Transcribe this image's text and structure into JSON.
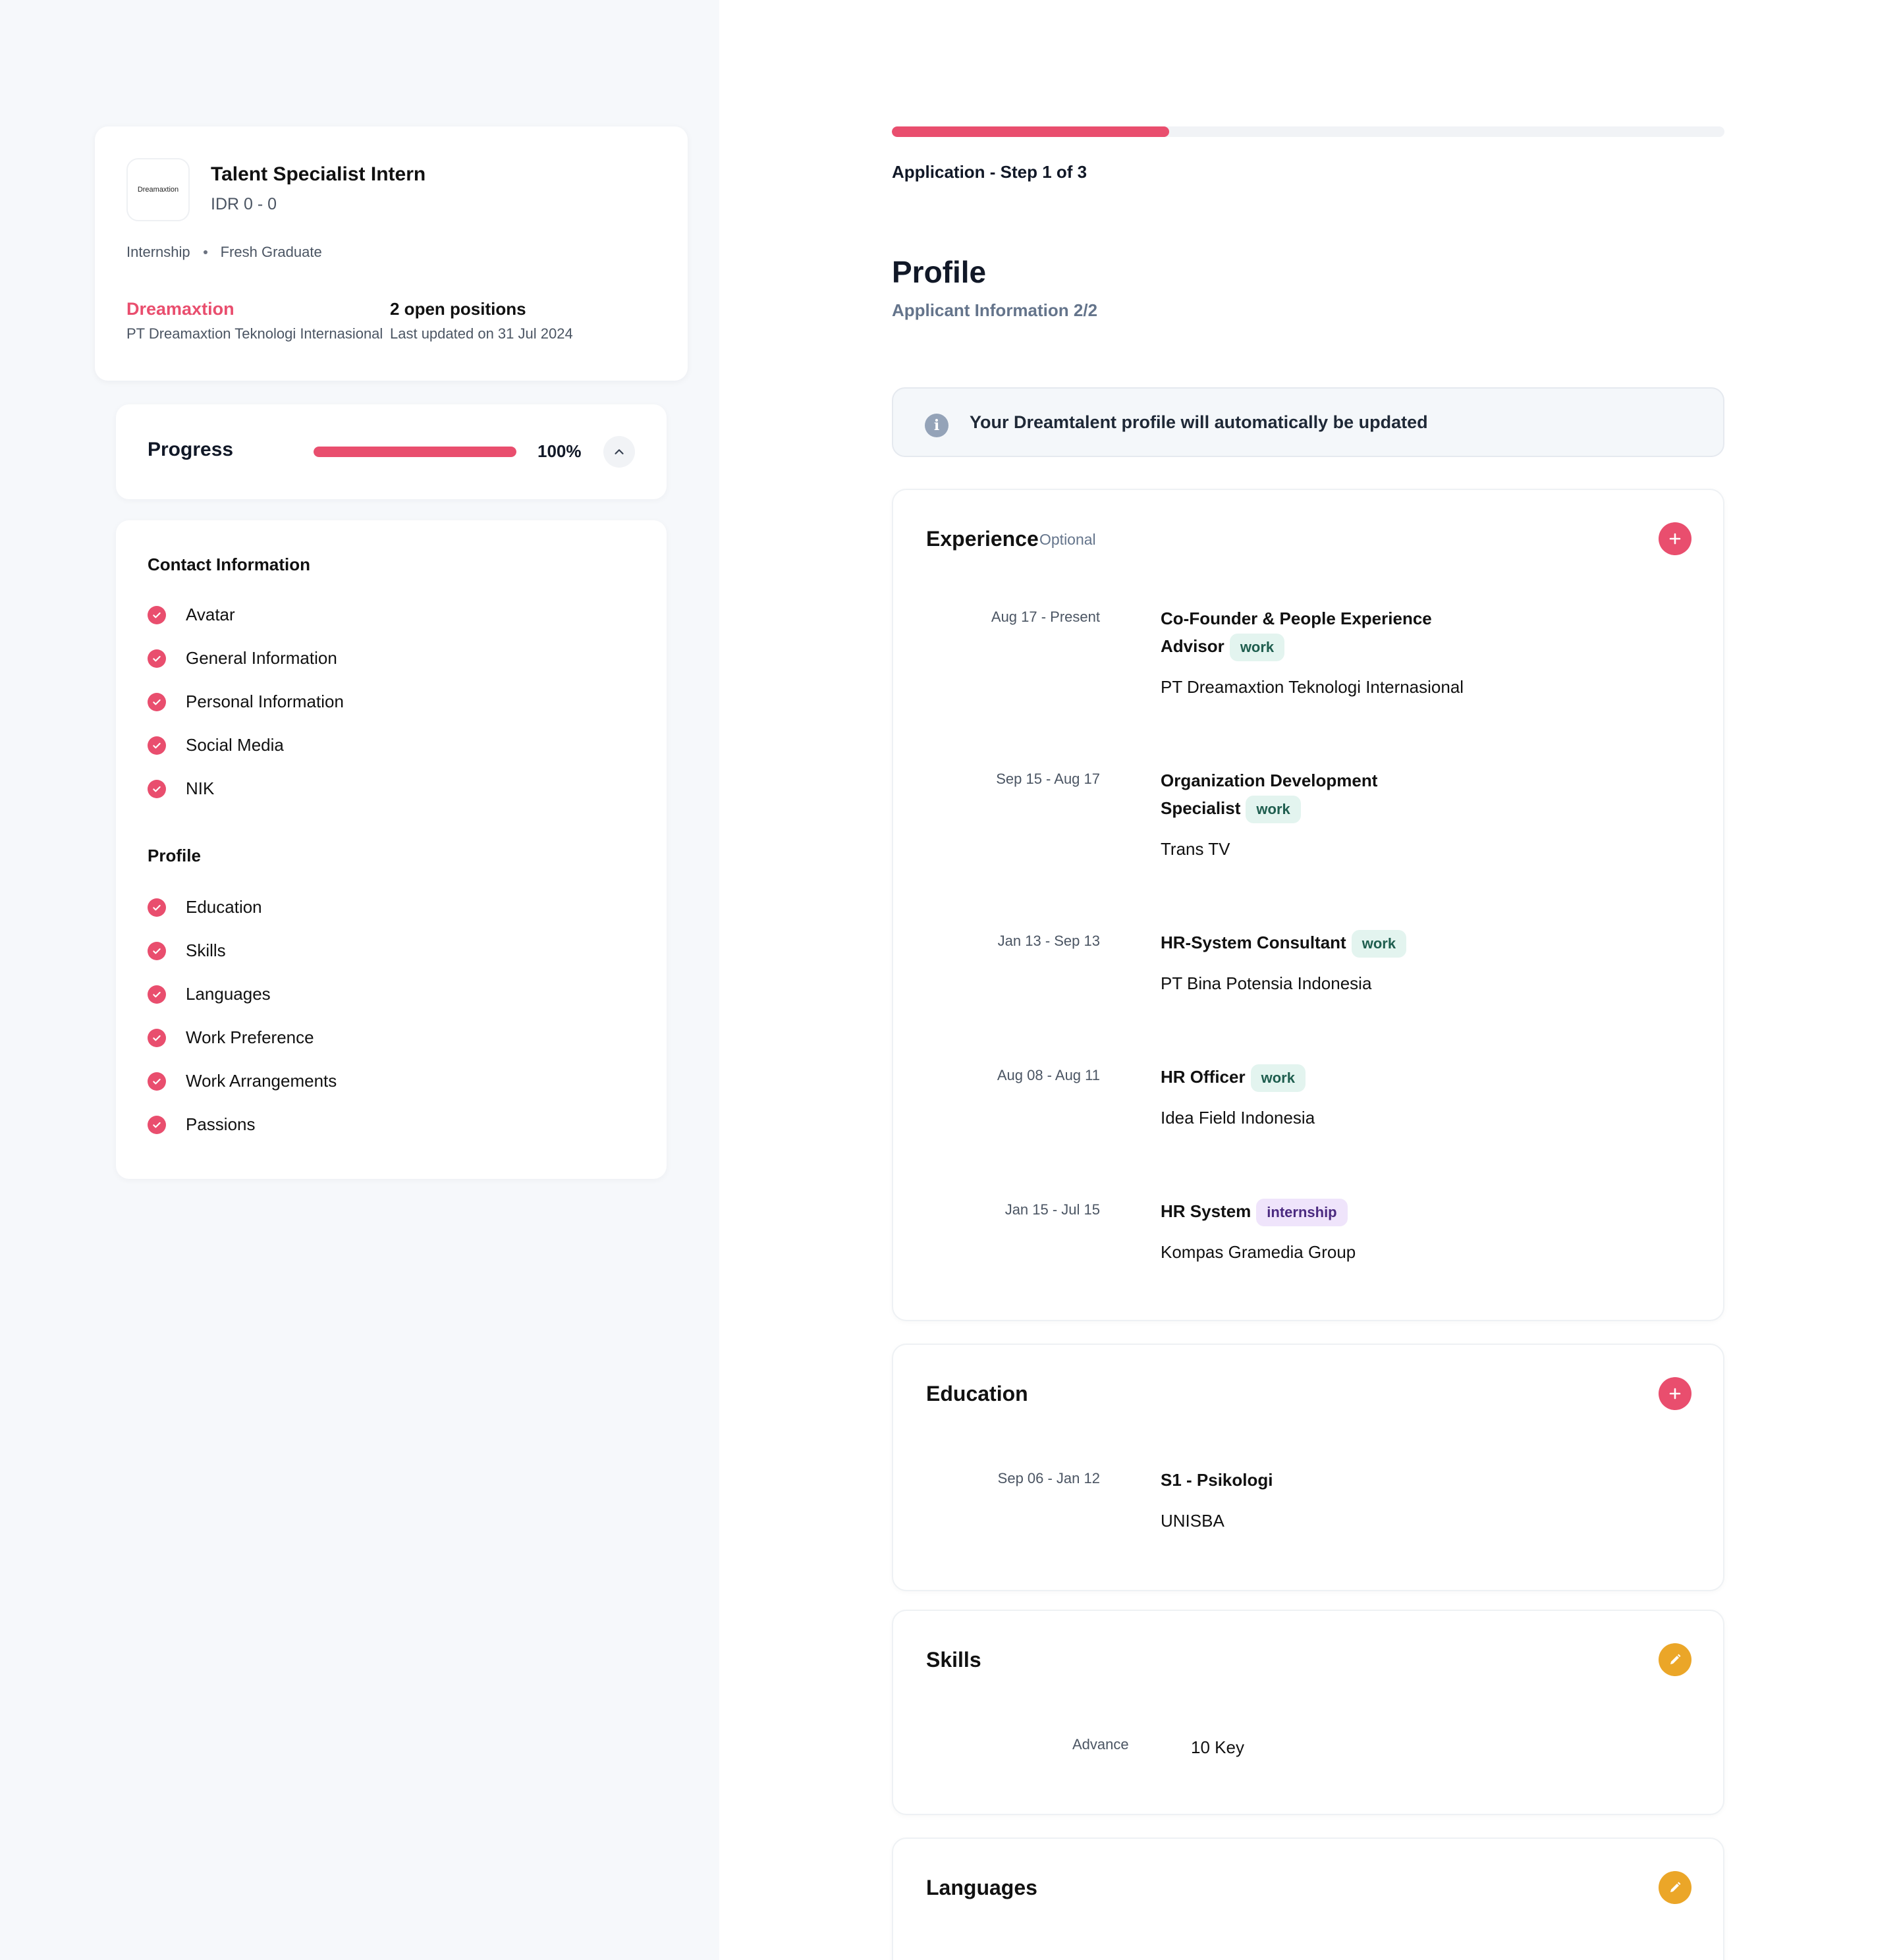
{
  "job": {
    "logo_text": "Dreamaxtion",
    "title": "Talent Specialist Intern",
    "salary": "IDR 0 - 0",
    "tags": [
      "Internship",
      "Fresh Graduate"
    ],
    "company": "Dreamaxtion",
    "company_legal": "PT Dreamaxtion Teknologi Internasional",
    "positions": "2 open positions",
    "updated": "Last updated on 31 Jul 2024"
  },
  "progress": {
    "label": "Progress",
    "value": 1.0,
    "percent_text": "100%"
  },
  "checklist": {
    "contact_heading": "Contact Information",
    "contact_items": [
      "Avatar",
      "General Information",
      "Personal Information",
      "Social Media",
      "NIK"
    ],
    "profile_heading": "Profile",
    "profile_items": [
      "Education",
      "Skills",
      "Languages",
      "Work Preference",
      "Work Arrangements",
      "Passions"
    ]
  },
  "application": {
    "step_value": 0.3333,
    "step_label": "Application - Step 1 of 3",
    "title": "Profile",
    "subtitle": "Applicant Information 2/2",
    "banner": "Your Dreamtalent profile will automatically be updated"
  },
  "experience": {
    "title": "Experience",
    "optional": "Optional",
    "entries": [
      {
        "period": "Aug 17 - Present",
        "role": "Co-Founder & People Experience Advisor",
        "type": "work",
        "org": "PT Dreamaxtion Teknologi Internasional"
      },
      {
        "period": "Sep 15 - Aug 17",
        "role": "Organization Development Specialist",
        "type": "work",
        "org": "Trans TV"
      },
      {
        "period": "Jan 13 - Sep 13",
        "role": "HR-System Consultant",
        "type": "work",
        "org": "PT Bina Potensia Indonesia"
      },
      {
        "period": "Aug 08 - Aug 11",
        "role": "HR Officer",
        "type": "work",
        "org": "Idea Field Indonesia"
      },
      {
        "period": "Jan 15 - Jul 15",
        "role": "HR System",
        "type": "internship",
        "org": "Kompas Gramedia Group"
      }
    ]
  },
  "education": {
    "title": "Education",
    "entries": [
      {
        "period": "Sep 06 - Jan 12",
        "degree": "S1 - Psikologi",
        "school": "UNISBA"
      }
    ]
  },
  "skills": {
    "title": "Skills",
    "entries": [
      {
        "level": "Advance",
        "name": "10 Key"
      }
    ]
  },
  "languages": {
    "title": "Languages"
  },
  "colors": {
    "accent": "#e94e6e",
    "edit": "#eba628",
    "work_badge_bg": "#e3f4ef",
    "internship_badge_bg": "#efe4fb"
  }
}
